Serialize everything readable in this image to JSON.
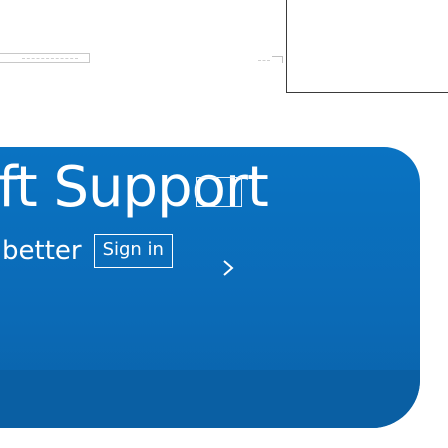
{
  "hero": {
    "title": "ft Support",
    "subtitle": "better",
    "signin_label": "Sign in",
    "next_icon": "chevron-right-icon"
  },
  "colors": {
    "hero_background": "#0a6ab6",
    "hero_text": "#ffffff",
    "border": "#3a3a3a"
  }
}
